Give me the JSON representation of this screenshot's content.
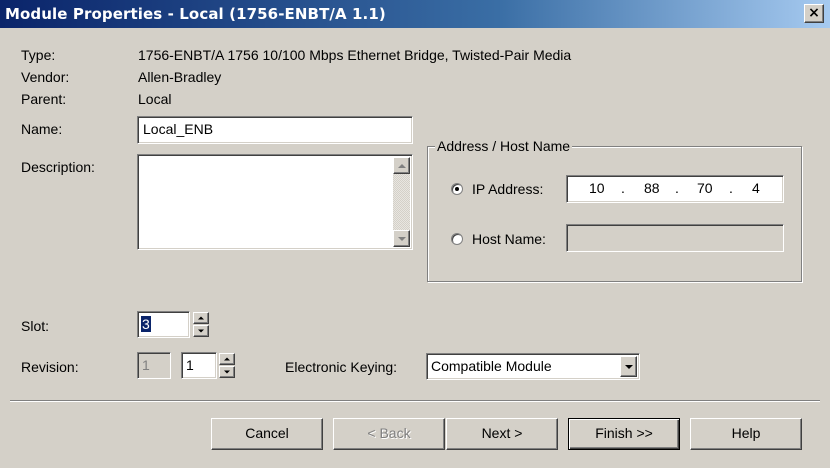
{
  "window": {
    "title": "Module Properties - Local (1756-ENBT/A 1.1)",
    "close_glyph": "×"
  },
  "info": {
    "type_label": "Type:",
    "type_value": "1756-ENBT/A 1756 10/100 Mbps Ethernet Bridge, Twisted-Pair Media",
    "vendor_label": "Vendor:",
    "vendor_value": "Allen-Bradley",
    "parent_label": "Parent:",
    "parent_value": "Local"
  },
  "name": {
    "label": "Name:",
    "value": "Local_ENB"
  },
  "description": {
    "label": "Description:",
    "value": ""
  },
  "address": {
    "group_label": "Address / Host Name",
    "ip_option_label": "IP Address:",
    "ip_selected": true,
    "ip_octets": [
      "10",
      "88",
      "70",
      "4"
    ],
    "ip_separator": ".",
    "host_option_label": "Host Name:",
    "host_value": ""
  },
  "slot": {
    "label": "Slot:",
    "value": "3"
  },
  "revision": {
    "label": "Revision:",
    "major": "1",
    "minor": "1"
  },
  "keying": {
    "label": "Electronic Keying:",
    "value": "Compatible Module"
  },
  "buttons": {
    "cancel": "Cancel",
    "back": "< Back",
    "next": "Next >",
    "finish": "Finish >>",
    "help": "Help"
  }
}
